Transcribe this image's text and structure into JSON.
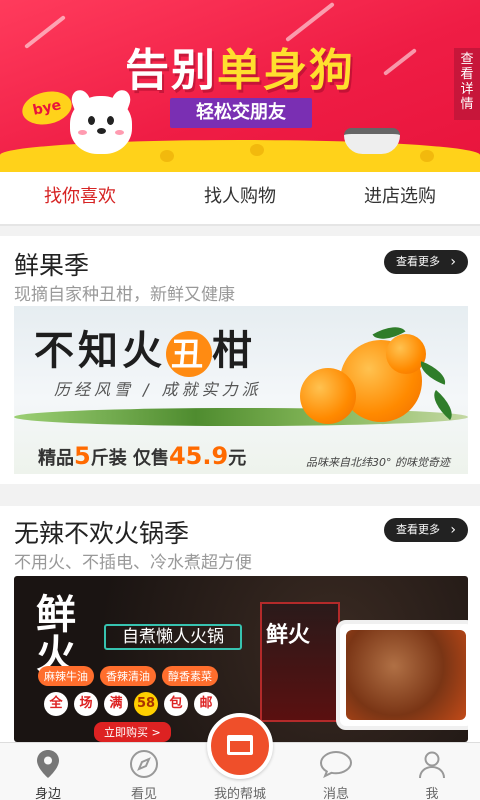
{
  "banner": {
    "title_part1": "告别",
    "title_part2": "单身狗",
    "subtitle": "轻松交朋友",
    "bye": "bye",
    "details_tab": "查看详情"
  },
  "tabs": [
    {
      "label": "找你喜欢",
      "active": true
    },
    {
      "label": "找人购物",
      "active": false
    },
    {
      "label": "进店选购",
      "active": false
    }
  ],
  "sections": [
    {
      "title": "鲜果季",
      "description": "现摘自家种丑柑，新鲜又健康",
      "more_label": "查看更多",
      "banner": {
        "headline_pre": "不知火",
        "headline_circle": "丑",
        "headline_post": "柑",
        "slogan": "历经风雪 / 成就实力派",
        "price_pre": "精品",
        "price_num": "5",
        "price_mid": "斤装 仅售",
        "price_value": "45.9",
        "price_unit": "元",
        "script": "品味来自北纬30° 的味觉奇迹"
      }
    },
    {
      "title": "无辣不欢火锅季",
      "description": "不用火、不插电、冷水煮超方便",
      "more_label": "查看更多",
      "banner": {
        "big1": "鲜",
        "big2": "火",
        "sign": "自煮懒人火锅",
        "pills": [
          "麻辣牛油",
          "香辣清油",
          "醇香素菜"
        ],
        "promo": [
          "全",
          "场",
          "满",
          "58",
          "包",
          "邮"
        ],
        "buy": "立即购买 >",
        "box_text": "鲜火"
      }
    }
  ],
  "nav": [
    {
      "label": "身边",
      "icon": "location-pin-icon",
      "active": true
    },
    {
      "label": "看见",
      "icon": "compass-icon",
      "active": false
    },
    {
      "label": "我的帮城",
      "icon": "store-icon",
      "active": false
    },
    {
      "label": "消息",
      "icon": "chat-bubble-icon",
      "active": false
    },
    {
      "label": "我",
      "icon": "user-icon",
      "active": false
    }
  ]
}
